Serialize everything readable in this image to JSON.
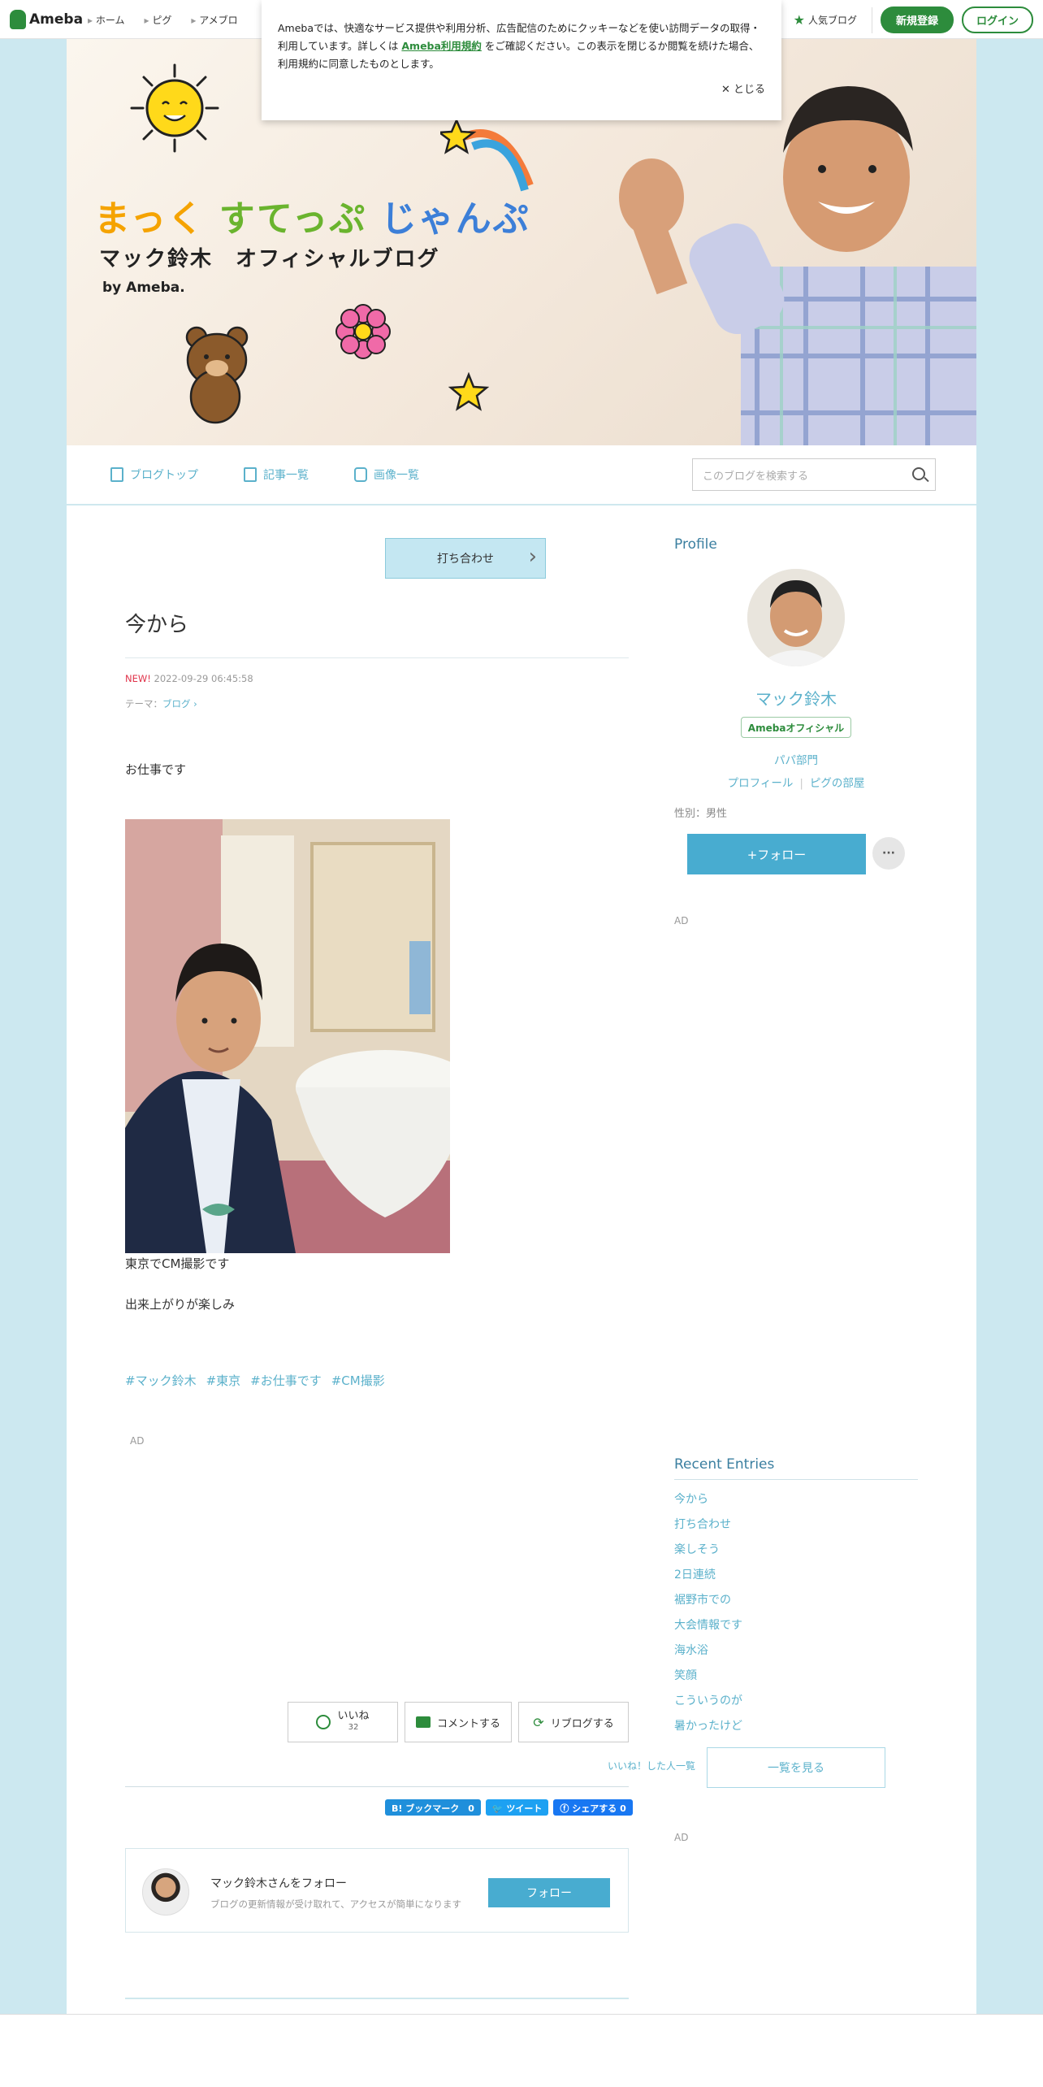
{
  "topbar": {
    "logo": "Ameba",
    "nav": [
      "ホーム",
      "ピグ",
      "アメブロ"
    ],
    "popular": "人気ブログ",
    "register": "新規登録",
    "login": "ログイン"
  },
  "cookie": {
    "text1": "Amebaでは、快適なサービス提供や利用分析、広告配信のためにクッキーなどを使い訪問データの取得・利用しています。詳しくは",
    "link": "Ameba利用規約",
    "text2": "をご確認ください。この表示を閉じるか閲覧を続けた場合、利用規約に同意したものとします。",
    "close": "✕ とじる"
  },
  "header": {
    "title_a": "まっく",
    "title_b": "すてっぷ",
    "title_c": "じゃんぷ",
    "subtitle": "マック鈴木　オフィシャルブログ",
    "by": "by Ameba."
  },
  "subnav": {
    "top": "ブログトップ",
    "entries": "記事一覧",
    "images": "画像一覧",
    "search_placeholder": "このブログを検索する"
  },
  "article": {
    "pinned": "打ち合わせ",
    "title": "今から",
    "new_label": "NEW!",
    "date": "2022-09-29 06:45:58",
    "theme_label": "テーマ：",
    "theme": "ブログ ›",
    "p1": "お仕事です",
    "p2": "東京でCM撮影です",
    "p3": "出来上がりが楽しみ",
    "hashtags": [
      "#マック鈴木",
      "#東京",
      "#お仕事です",
      "#CM撮影"
    ],
    "ad": "AD",
    "like": "いいね",
    "like_count": "32",
    "comment": "コメントする",
    "reblog": "リブログする",
    "like_list": "いいね！した人一覧",
    "bookmark": "B! ブックマーク　0",
    "tweet": "ツイート",
    "share": "シェアする 0",
    "follow_title": "マック鈴木さんをフォロー",
    "follow_desc": "ブログの更新情報が受け取れて、アクセスが簡単になります",
    "follow_btn": "フォロー"
  },
  "sidebar": {
    "profile_heading": "Profile",
    "name": "マック鈴木",
    "official": "Amebaオフィシャル",
    "category": "パパ部門",
    "profile_link": "プロフィール",
    "pig_link": "ピグの部屋",
    "gender": "性別：男性",
    "follow": "+フォロー",
    "more": "···",
    "ad1": "AD",
    "recent_heading": "Recent Entries",
    "recent": [
      "今から",
      "打ち合わせ",
      "楽しそう",
      "2日連続",
      "裾野市での",
      "大会情報です",
      "海水浴",
      "笑顔",
      "こういうのが",
      "暑かったけど"
    ],
    "see_all": "一覧を見る",
    "ad2": "AD"
  },
  "colors": {
    "brand": "#2d8c3c",
    "accent": "#48acd0",
    "link": "#5bb1cb",
    "bg": "#cce8f0",
    "new": "#e0334a"
  }
}
